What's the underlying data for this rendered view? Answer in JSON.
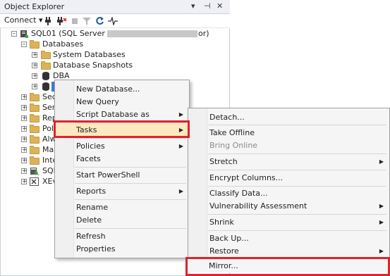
{
  "panel": {
    "title": "Object Explorer",
    "title_buttons": [
      "▾",
      "⊣",
      "✕"
    ]
  },
  "toolbar": {
    "connect_label": "Connect",
    "connect_arrow": "▾"
  },
  "tree": {
    "server_prefix": "SQL01 (SQL Server",
    "server_suffix": "or)",
    "databases": "Databases",
    "system_databases": "System Databases",
    "database_snapshots": "Database Snapshots",
    "dba": "DBA",
    "security": "Secu",
    "server_objects": "Serv",
    "replication": "Rep",
    "polybase": "Poly",
    "always_on": "Alw",
    "management": "Mar",
    "integration": "Inte",
    "sql_agent": "SQL",
    "xevent": "XEve"
  },
  "context_menu": {
    "items": [
      {
        "label": "New Database..."
      },
      {
        "label": "New Query"
      },
      {
        "label": "Script Database as",
        "arrow": "▶"
      },
      {
        "label": "Tasks",
        "arrow": "▶"
      },
      {
        "label": "Policies",
        "arrow": "▶"
      },
      {
        "label": "Facets"
      },
      {
        "label": "Start PowerShell"
      },
      {
        "label": "Reports",
        "arrow": "▶"
      },
      {
        "label": "Rename"
      },
      {
        "label": "Delete"
      },
      {
        "label": "Refresh"
      },
      {
        "label": "Properties"
      }
    ]
  },
  "tasks_submenu": {
    "items": [
      {
        "label": "Detach..."
      },
      {
        "label": "Take Offline"
      },
      {
        "label": "Bring Online"
      },
      {
        "label": "Stretch",
        "arrow": "▶"
      },
      {
        "label": "Encrypt Columns..."
      },
      {
        "label": "Classify Data..."
      },
      {
        "label": "Vulnerability Assessment",
        "arrow": "▶"
      },
      {
        "label": "Shrink",
        "arrow": "▶"
      },
      {
        "label": "Back Up..."
      },
      {
        "label": "Restore",
        "arrow": "▶"
      },
      {
        "label": "Mirror..."
      }
    ]
  },
  "colors": {
    "highlight_box": "#e0222b",
    "menu_highlight": "#fde9bf",
    "folder": "#dcb25a"
  }
}
